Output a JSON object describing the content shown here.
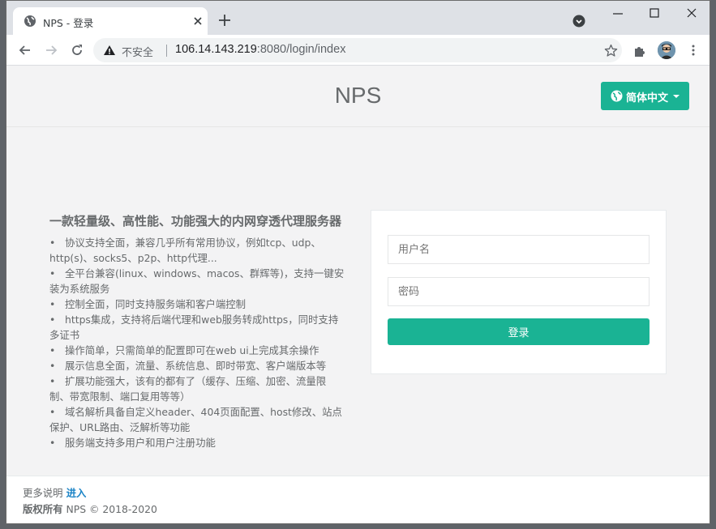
{
  "browser": {
    "tab_title": "NPS - 登录",
    "insecure_label": "不安全",
    "url_host": "106.14.143.219",
    "url_rest": ":8080/login/index",
    "accent": "#1ab394"
  },
  "header": {
    "brand": "NPS",
    "language_button": "简体中文"
  },
  "intro": {
    "title": "一款轻量级、高性能、功能强大的内网穿透代理服务器",
    "features": [
      "协议支持全面，兼容几乎所有常用协议，例如tcp、udp、http(s)、socks5、p2p、http代理...",
      "全平台兼容(linux、windows、macos、群辉等)，支持一键安装为系统服务",
      "控制全面，同时支持服务端和客户端控制",
      "https集成，支持将后端代理和web服务转成https，同时支持多证书",
      "操作简单，只需简单的配置即可在web ui上完成其余操作",
      "展示信息全面，流量、系统信息、即时带宽、客户端版本等",
      "扩展功能强大，该有的都有了（缓存、压缩、加密、流量限制、带宽限制、端口复用等等）",
      "域名解析具备自定义header、404页面配置、host修改、站点保护、URL路由、泛解析等功能",
      "服务端支持多用户和用户注册功能"
    ]
  },
  "login": {
    "username_placeholder": "用户名",
    "password_placeholder": "密码",
    "submit_label": "登录"
  },
  "footer": {
    "more_label": "更多说明",
    "more_link": "进入",
    "copyright_bold": "版权所有",
    "copyright_text": "NPS © 2018-2020"
  }
}
